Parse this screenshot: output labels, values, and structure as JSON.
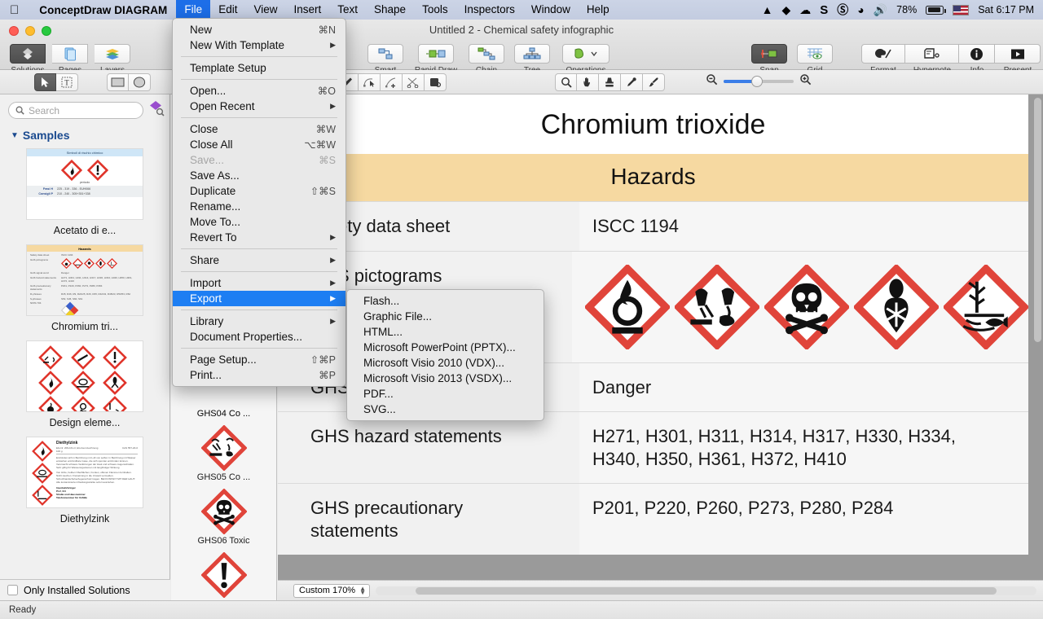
{
  "menubar": {
    "apple_icon": "apple-icon",
    "app_name": "ConceptDraw DIAGRAM",
    "menus": [
      "File",
      "Edit",
      "View",
      "Insert",
      "Text",
      "Shape",
      "Tools",
      "Inspectors",
      "Window",
      "Help"
    ],
    "active_menu": "File",
    "status_icons": [
      "vlc-icon",
      "diamond-icon",
      "cloud-upload-icon",
      "s-icon",
      "skype-icon",
      "wifi-icon",
      "volume-icon"
    ],
    "battery_percent": "78%",
    "input_flag": "us-flag-icon",
    "clock": "Sat 6:17 PM"
  },
  "window": {
    "title": "Untitled 2 - Chemical safety infographic",
    "left_toolbar": [
      {
        "label": "Solutions",
        "icon": "solutions-icon",
        "active": true
      },
      {
        "label": "Pages",
        "icon": "pages-icon",
        "active": false
      },
      {
        "label": "Layers",
        "icon": "layers-icon",
        "active": false
      }
    ],
    "center_toolbar": [
      {
        "label": "Smart",
        "icon": "smart-connector-icon"
      },
      {
        "label": "Rapid Draw",
        "icon": "rapid-draw-icon"
      },
      {
        "label": "Chain",
        "icon": "chain-icon"
      },
      {
        "label": "Tree",
        "icon": "tree-icon"
      },
      {
        "label": "Operations",
        "icon": "operations-icon"
      }
    ],
    "right_toolbar": [
      {
        "label": "Snap",
        "icon": "snap-icon",
        "active": true
      },
      {
        "label": "Grid",
        "icon": "grid-icon",
        "active": false
      },
      {
        "label": "Format",
        "icon": "format-palette-icon",
        "active": false
      },
      {
        "label": "Hypernote",
        "icon": "hypernote-icon",
        "active": false
      },
      {
        "label": "Info",
        "icon": "info-icon",
        "active": false
      },
      {
        "label": "Present",
        "icon": "present-icon",
        "active": false
      }
    ],
    "tools_row": {
      "selection_tools": [
        "pointer-tool-icon",
        "text-tool-icon"
      ],
      "shape_tools": [
        "rectangle-tool-icon",
        "ellipse-tool-icon"
      ],
      "path_tools": [
        "pen-tool-icon",
        "edit-point-tool-icon",
        "add-point-tool-icon",
        "scissors-tool-icon",
        "fill-tool-icon"
      ],
      "view_tools": [
        "zoom-tool-icon",
        "hand-tool-icon",
        "stamp-tool-icon",
        "eyedropper-tool-icon",
        "paintbrush-tool-icon"
      ],
      "zoom_out_icon": "zoom-out-icon",
      "zoom_in_icon": "zoom-in-icon"
    }
  },
  "file_menu": {
    "items": [
      {
        "label": "New",
        "shortcut": "⌘N"
      },
      {
        "label": "New With Template",
        "submenu": true
      },
      {
        "sep": true
      },
      {
        "label": "Template Setup"
      },
      {
        "sep": true
      },
      {
        "label": "Open...",
        "shortcut": "⌘O"
      },
      {
        "label": "Open Recent",
        "submenu": true
      },
      {
        "sep": true
      },
      {
        "label": "Close",
        "shortcut": "⌘W"
      },
      {
        "label": "Close All",
        "shortcut": "⌥⌘W"
      },
      {
        "label": "Save...",
        "shortcut": "⌘S",
        "disabled": true
      },
      {
        "label": "Save As..."
      },
      {
        "label": "Duplicate",
        "shortcut": "⇧⌘S"
      },
      {
        "label": "Rename..."
      },
      {
        "label": "Move To..."
      },
      {
        "label": "Revert To",
        "submenu": true
      },
      {
        "sep": true
      },
      {
        "label": "Share",
        "submenu": true
      },
      {
        "sep": true
      },
      {
        "label": "Import",
        "submenu": true
      },
      {
        "label": "Export",
        "submenu": true,
        "highlighted": true
      },
      {
        "sep": true
      },
      {
        "label": "Library",
        "submenu": true
      },
      {
        "label": "Document Properties..."
      },
      {
        "sep": true
      },
      {
        "label": "Page Setup...",
        "shortcut": "⇧⌘P"
      },
      {
        "label": "Print...",
        "shortcut": "⌘P"
      }
    ]
  },
  "export_submenu": {
    "items": [
      "Flash...",
      "Graphic File...",
      "HTML...",
      "Microsoft PowerPoint (PPTX)...",
      "Microsoft Visio 2010 (VDX)...",
      "Microsoft Visio 2013 (VSDX)...",
      "PDF...",
      "SVG..."
    ]
  },
  "sidebar": {
    "search": {
      "placeholder": "Search",
      "icon": "search-icon"
    },
    "solutions_icon": "solutions-badge-icon",
    "section": {
      "label": "Samples",
      "disclosure": "triangle-down-icon"
    },
    "samples": [
      {
        "caption": "Acetato di e...",
        "thumb": "acetato-thumbnail"
      },
      {
        "caption": "Chromium tri...",
        "thumb": "chromium-thumbnail"
      },
      {
        "caption": "Design eleme...",
        "thumb": "design-elements-thumbnail"
      },
      {
        "caption": "Diethylzink",
        "thumb": "diethylzink-thumbnail"
      }
    ],
    "only_installed": {
      "label": "Only Installed Solutions",
      "checked": false
    }
  },
  "shapes_panel": {
    "items": [
      {
        "caption": "GHS04 Co ...",
        "icon": "ghs04-gas-cylinder-icon"
      },
      {
        "caption": "GHS05 Co ...",
        "icon": "ghs05-corrosion-icon"
      },
      {
        "caption": "GHS06 Toxic",
        "icon": "ghs06-skull-icon"
      },
      {
        "caption": "",
        "icon": "ghs07-exclamation-icon"
      }
    ]
  },
  "document": {
    "title": "Chromium trioxide",
    "section_header": "Hazards",
    "header_color": "#f6d9a1",
    "rows": [
      {
        "label": "Safety data sheet",
        "value": "ISCC 1194",
        "type": "text"
      },
      {
        "label": "GHS pictograms",
        "type": "pictograms",
        "pictograms": [
          "oxidizer-icon",
          "corrosion-icon",
          "skull-crossbones-icon",
          "health-hazard-icon",
          "environment-icon"
        ]
      },
      {
        "label": "GHS signal word",
        "value": "Danger",
        "type": "text"
      },
      {
        "label": "GHS hazard statements",
        "value": "H271, H301, H311, H314, H317, H330, H334, H340, H350, H361, H372, H410",
        "type": "text"
      },
      {
        "label": "GHS precautionary statements",
        "value": "P201, P220, P260, P273, P280, P284",
        "type": "text"
      }
    ]
  },
  "zoombar": {
    "zoom_value": "Custom 170%",
    "stepper_icon": "stepper-icon"
  },
  "statusbar": {
    "text": "Ready"
  }
}
